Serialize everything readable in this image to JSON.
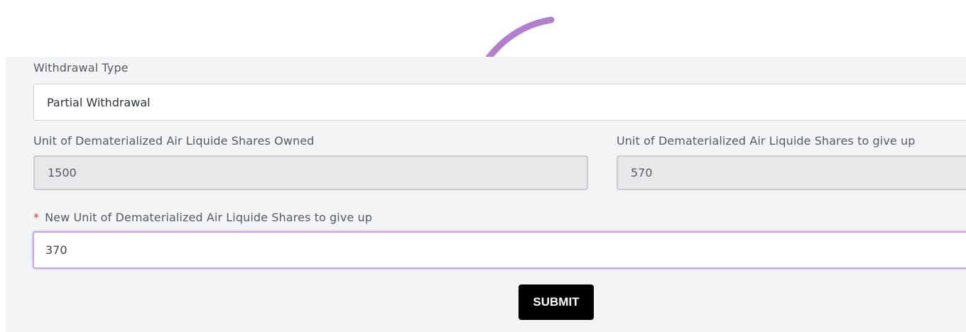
{
  "form": {
    "withdrawal_type_label": "Withdrawal Type",
    "withdrawal_type_value": "Partial Withdrawal",
    "shares_owned_label": "Unit of Dematerialized Air Liquide Shares Owned",
    "shares_owned_value": "1500",
    "shares_to_give_up_label": "Unit of Dematerialized Air Liquide Shares to give up",
    "shares_to_give_up_value": "570",
    "required_marker": "*",
    "new_shares_label": "New Unit of Dematerialized Air Liquide Shares to give up",
    "new_shares_value": "370",
    "submit_label": "SUBMIT"
  },
  "colors": {
    "annotation_arrow": "#b07fd0",
    "active_border": "#c7a6de",
    "submit_bg": "#000000",
    "required": "#d23c3c"
  },
  "icons": {
    "annotation": "curved-arrow-icon"
  }
}
